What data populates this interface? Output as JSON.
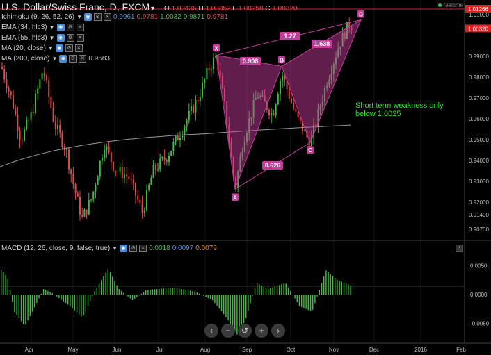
{
  "header": {
    "title": "U.S. Dollar/Swiss Franc, D, FXCM",
    "ohlc": [
      {
        "k": "O",
        "v": "1.00436"
      },
      {
        "k": "H",
        "v": "1.00852"
      },
      {
        "k": "L",
        "v": "1.00258"
      },
      {
        "k": "C",
        "v": "1.00320"
      }
    ],
    "realtime": "realtime"
  },
  "indicators": [
    {
      "label": "Ichimoku (9, 26, 52, 26)",
      "values": [
        {
          "t": "0.9961",
          "c": "blue"
        },
        {
          "t": "0.9781",
          "c": "red"
        },
        {
          "t": "1.0032",
          "c": "green"
        },
        {
          "t": "0.9871",
          "c": "green"
        },
        {
          "t": "0.9781",
          "c": "red"
        }
      ]
    },
    {
      "label": "EMA (34, hlc3)",
      "values": []
    },
    {
      "label": "EMA (55, hlc3)",
      "values": []
    },
    {
      "label": "MA (20, close)",
      "values": []
    },
    {
      "label": "MA (200, close)",
      "values": [
        {
          "t": "0.9583",
          "c": "gray"
        }
      ]
    }
  ],
  "macd": {
    "label": "MACD (12, 26, close, 9, false, true)",
    "values": [
      {
        "t": "0.0018",
        "c": "green"
      },
      {
        "t": "0.0097",
        "c": "blue"
      },
      {
        "t": "0.0079",
        "c": "orange"
      }
    ]
  },
  "price_axis": [
    "1.01000",
    "0.99000",
    "0.98000",
    "0.97000",
    "0.96000",
    "0.95000",
    "0.94000",
    "0.93000",
    "0.92000",
    "0.91400",
    "0.90700"
  ],
  "price_tags": {
    "high": "1.01266",
    "last": "1.00320"
  },
  "macd_axis": [
    "0.0050",
    "0.0000",
    "-0.0050"
  ],
  "time_axis": [
    "Apr",
    "May",
    "Jun",
    "Jul",
    "Aug",
    "Sep",
    "Oct",
    "Nov",
    "Dec",
    "2016",
    "Feb"
  ],
  "pattern": {
    "points": [
      "X",
      "A",
      "B",
      "C",
      "D"
    ],
    "ratios": {
      "xb": "0.908",
      "ac": "0.626",
      "bd": "1.638",
      "xd": "1.27"
    }
  },
  "annotation": "Short term weakness only below 1.0025",
  "nav": [
    "‹",
    "−",
    "↺",
    "+",
    "›"
  ],
  "colors": {
    "up": "#3cbf3c",
    "down": "#e04848",
    "pattern": "#c23c9a",
    "text_note": "#33dd33",
    "highline": "#e02020"
  }
}
